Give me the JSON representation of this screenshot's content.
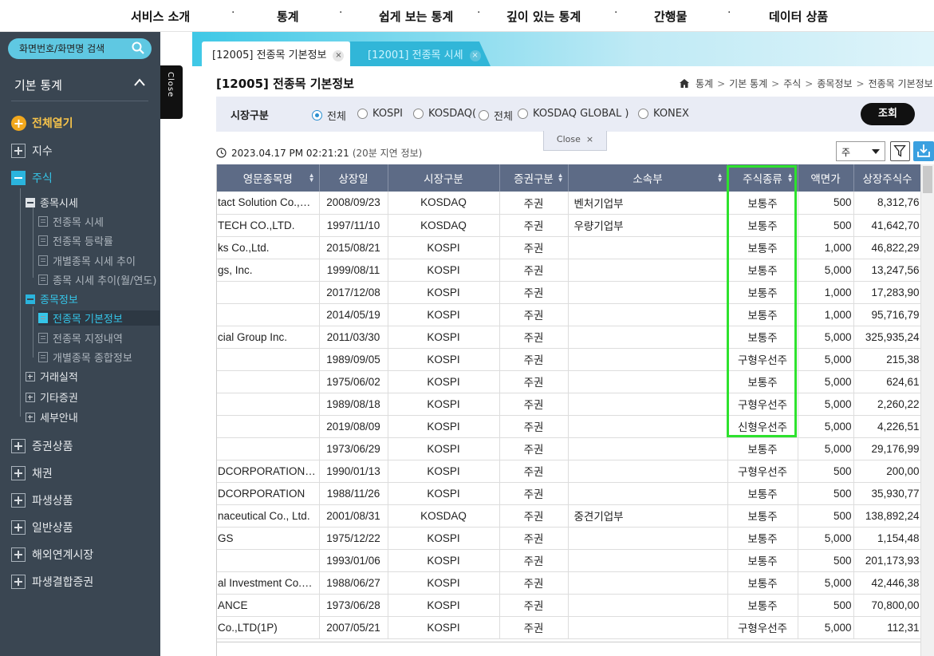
{
  "topnav": {
    "items": [
      "서비스 소개",
      "통계",
      "쉽게 보는 통계",
      "깊이 있는 통계",
      "간행물",
      "데이터 상품"
    ],
    "separator": "·"
  },
  "sidebar": {
    "search_placeholder": "화면번호/화면명 검색",
    "header": "기본 통계",
    "open_all": "전체열기",
    "index": "지수",
    "stock": "주식",
    "stock_price": "종목시세",
    "price_items": [
      "전종목 시세",
      "전종목 등락률",
      "개별종목 시세 추이",
      "종목 시세 추이(월/연도)"
    ],
    "stock_info": "종목정보",
    "info_items": [
      "전종목 기본정보",
      "전종목 지정내역",
      "개별종목 종합정보"
    ],
    "sub_items": [
      "거래실적",
      "기타증권",
      "세부안내"
    ],
    "bottom_items": [
      "증권상품",
      "채권",
      "파생상품",
      "일반상품",
      "해외연계시장",
      "파생결합증권"
    ]
  },
  "close_tab": "Close",
  "tabs": [
    {
      "label": "[12005] 전종목 기본정보",
      "close": "×"
    },
    {
      "label": "[12001] 전종목 시세",
      "close": "×"
    }
  ],
  "page_title": "[12005] 전종목 기본정보",
  "breadcrumb": [
    "통계",
    "기본 통계",
    "주식",
    "종목정보",
    "전종목 기본정보"
  ],
  "breadcrumb_sep": ">",
  "filter": {
    "label": "시장구분",
    "options": [
      "전체",
      "KOSPI",
      "KOSDAQ(",
      "전체",
      "KOSDAQ GLOBAL )",
      "KONEX"
    ],
    "selected": "전체",
    "search_button": "조회"
  },
  "close_bar": {
    "label": "Close",
    "icon": "×"
  },
  "timestamp": "2023.04.17 PM 02:21:21",
  "delay_note": "(20분 지연 정보)",
  "unit_select": "주",
  "table": {
    "headers": [
      "영문종목명",
      "상장일",
      "시장구분",
      "증권구분",
      "소속부",
      "주식종류",
      "액면가",
      "상장주식수"
    ],
    "rows": [
      [
        "tact Solution Co.,…",
        "2008/09/23",
        "KOSDAQ",
        "주권",
        "벤처기업부",
        "보통주",
        "500",
        "8,312,76"
      ],
      [
        "TECH CO.,LTD.",
        "1997/11/10",
        "KOSDAQ",
        "주권",
        "우량기업부",
        "보통주",
        "500",
        "41,642,70"
      ],
      [
        "ks Co.,Ltd.",
        "2015/08/21",
        "KOSPI",
        "주권",
        "",
        "보통주",
        "1,000",
        "46,822,29"
      ],
      [
        "gs, Inc.",
        "1999/08/11",
        "KOSPI",
        "주권",
        "",
        "보통주",
        "5,000",
        "13,247,56"
      ],
      [
        "",
        "2017/12/08",
        "KOSPI",
        "주권",
        "",
        "보통주",
        "1,000",
        "17,283,90"
      ],
      [
        "",
        "2014/05/19",
        "KOSPI",
        "주권",
        "",
        "보통주",
        "1,000",
        "95,716,79"
      ],
      [
        "cial Group Inc.",
        "2011/03/30",
        "KOSPI",
        "주권",
        "",
        "보통주",
        "5,000",
        "325,935,24"
      ],
      [
        "",
        "1989/09/05",
        "KOSPI",
        "주권",
        "",
        "구형우선주",
        "5,000",
        "215,38"
      ],
      [
        "",
        "1975/06/02",
        "KOSPI",
        "주권",
        "",
        "보통주",
        "5,000",
        "624,61"
      ],
      [
        "",
        "1989/08/18",
        "KOSPI",
        "주권",
        "",
        "구형우선주",
        "5,000",
        "2,260,22"
      ],
      [
        "",
        "2019/08/09",
        "KOSPI",
        "주권",
        "",
        "신형우선주",
        "5,000",
        "4,226,51"
      ],
      [
        "",
        "1973/06/29",
        "KOSPI",
        "주권",
        "",
        "보통주",
        "5,000",
        "29,176,99"
      ],
      [
        "DCORPORATION(…",
        "1990/01/13",
        "KOSPI",
        "주권",
        "",
        "구형우선주",
        "500",
        "200,00"
      ],
      [
        "DCORPORATION",
        "1988/11/26",
        "KOSPI",
        "주권",
        "",
        "보통주",
        "500",
        "35,930,77"
      ],
      [
        "naceutical Co., Ltd.",
        "2001/08/31",
        "KOSDAQ",
        "주권",
        "중견기업부",
        "보통주",
        "500",
        "138,892,24"
      ],
      [
        "GS",
        "1975/12/22",
        "KOSPI",
        "주권",
        "",
        "보통주",
        "5,000",
        "1,154,48"
      ],
      [
        "",
        "1993/01/06",
        "KOSPI",
        "주권",
        "",
        "보통주",
        "500",
        "201,173,93"
      ],
      [
        "al Investment Co.…",
        "1988/06/27",
        "KOSPI",
        "주권",
        "",
        "보통주",
        "5,000",
        "42,446,38"
      ],
      [
        "ANCE",
        "1973/06/28",
        "KOSPI",
        "주권",
        "",
        "보통주",
        "500",
        "70,800,00"
      ],
      [
        "Co.,LTD(1P)",
        "2007/05/21",
        "KOSPI",
        "주권",
        "",
        "구형우선주",
        "5,000",
        "112,31"
      ]
    ]
  }
}
